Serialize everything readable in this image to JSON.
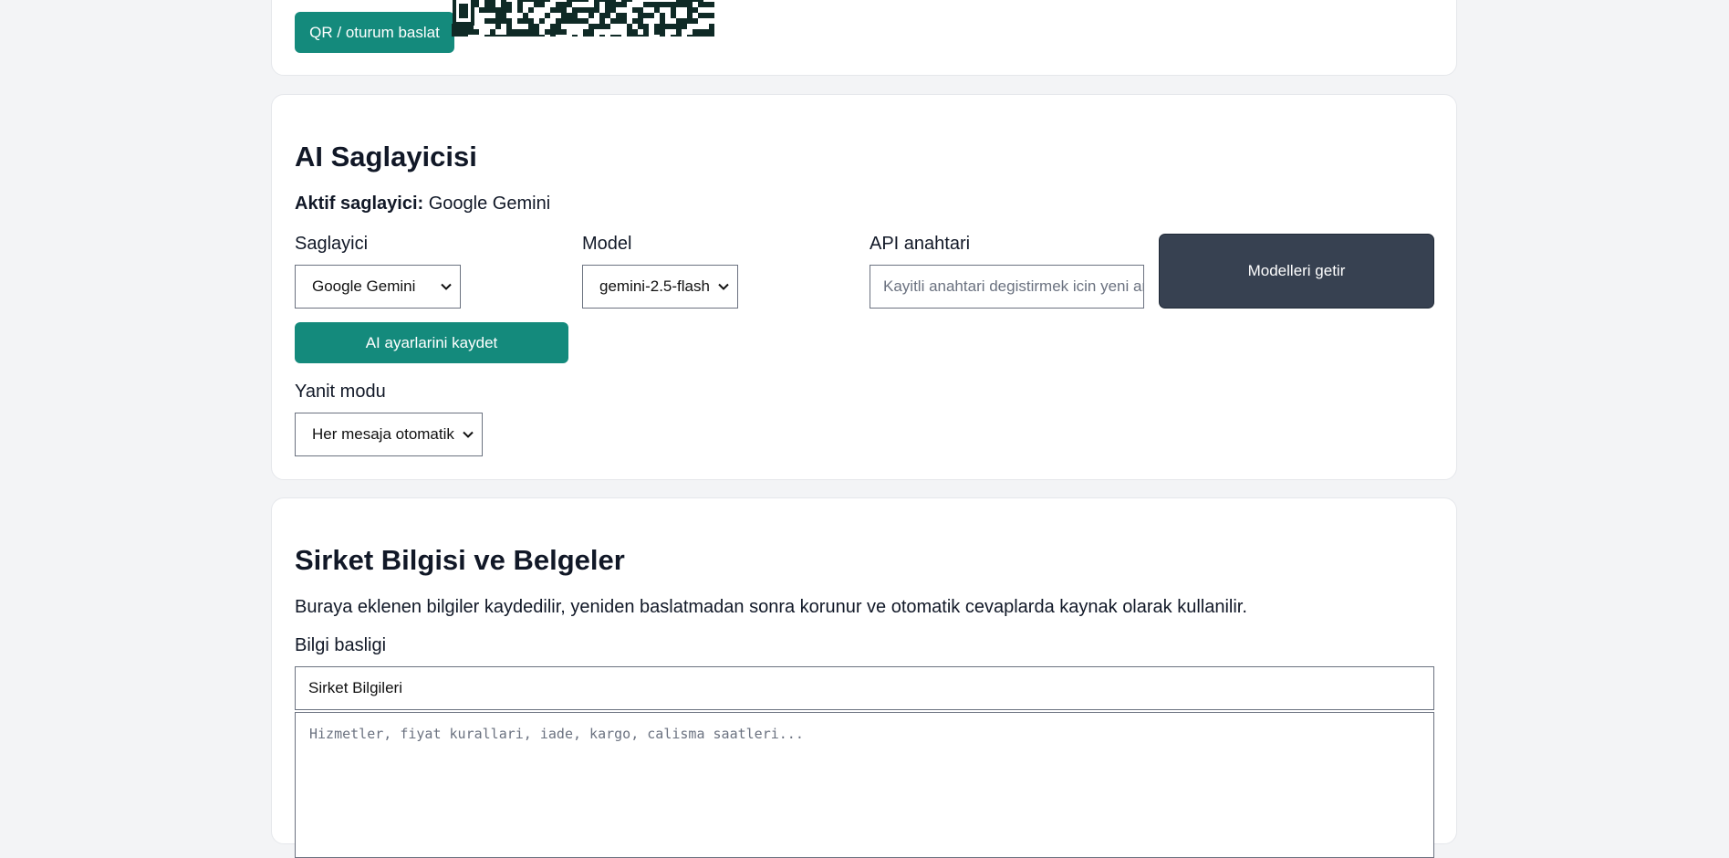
{
  "qr_section": {
    "start_button_label": "QR / oturum baslat"
  },
  "ai_section": {
    "title": "AI Saglayicisi",
    "active_label": "Aktif saglayici:",
    "active_value": "Google Gemini",
    "provider_label": "Saglayici",
    "provider_value": "Google Gemini",
    "model_label": "Model",
    "model_value": "gemini-2.5-flash",
    "api_key_label": "API anahtari",
    "api_key_placeholder": "Kayitli anahtari degistirmek icin yeni anahtar",
    "fetch_models_label": "Modelleri getir",
    "save_label": "AI ayarlarini kaydet",
    "reply_mode_label": "Yanit modu",
    "reply_mode_value": "Her mesaja otomatik"
  },
  "company_section": {
    "title": "Sirket Bilgisi ve Belgeler",
    "description": "Buraya eklenen bilgiler kaydedilir, yeniden baslatmadan sonra korunur ve otomatik cevaplarda kaynak olarak kullanilir.",
    "info_title_label": "Bilgi basligi",
    "info_title_value": "Sirket Bilgileri",
    "content_placeholder": "Hizmetler, fiyat kurallari, iade, kargo, calisma saatleri..."
  },
  "colors": {
    "accent": "#148a7c",
    "dark_button": "#374151",
    "background": "#f3f4f6"
  }
}
